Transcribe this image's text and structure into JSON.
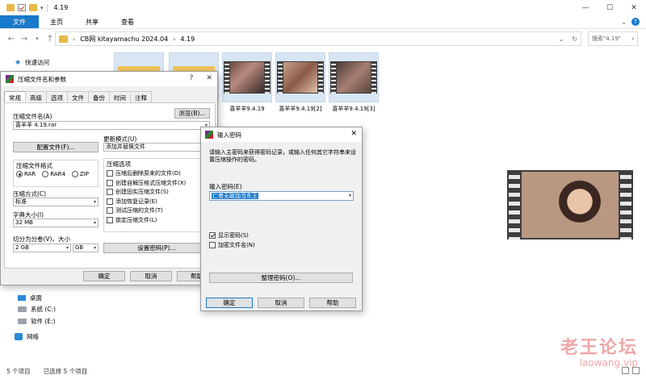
{
  "explorer": {
    "title": "4.19",
    "tabs": [
      "文件",
      "主页",
      "共享",
      "查看"
    ],
    "breadcrumb": [
      "CB网 kitayamachu 2024.04",
      "4.19"
    ],
    "search_placeholder": "搜索\"4.19\"",
    "nav": {
      "quick_access": "快速访问",
      "desktop": "桌面",
      "system_drive": "系统 (C:)",
      "software_drive": "软件 (E:)",
      "network": "网络"
    },
    "files": [
      {
        "type": "folder",
        "name": ""
      },
      {
        "type": "folder",
        "name": ""
      },
      {
        "type": "video",
        "name": "喜羊羊9.4.19"
      },
      {
        "type": "video",
        "name": "喜羊羊9.4.19[2]"
      },
      {
        "type": "video",
        "name": "喜羊羊9.4.19[3]"
      }
    ],
    "status": {
      "count": "5 个项目",
      "selected": "已选择 5 个项目"
    }
  },
  "archive_dialog": {
    "title": "压缩文件名和参数",
    "help": "?",
    "tabs": [
      "常规",
      "高级",
      "选项",
      "文件",
      "备份",
      "时间",
      "注释"
    ],
    "archive_name_label": "压缩文件名(A)",
    "browse_button": "浏览(B)...",
    "archive_name": "喜羊羊 4.19.rar",
    "update_mode_label": "更新模式(U)",
    "update_mode": "添加并替换文件",
    "profiles_button": "配置文件(F)...",
    "format_label": "压缩文件格式",
    "formats": [
      "RAR",
      "RAR4",
      "ZIP"
    ],
    "selected_format": "RAR",
    "options_label": "压缩选项",
    "options": [
      {
        "label": "压缩后删除原来的文件(D)",
        "checked": false
      },
      {
        "label": "创建自解压格式压缩文件(X)",
        "checked": false
      },
      {
        "label": "创建固实压缩文件(S)",
        "checked": false
      },
      {
        "label": "添加恢复记录(E)",
        "checked": false
      },
      {
        "label": "测试压缩的文件(T)",
        "checked": false
      },
      {
        "label": "锁定压缩文件(L)",
        "checked": false
      }
    ],
    "method_label": "压缩方式(C)",
    "method": "标准",
    "dict_label": "字典大小(I)",
    "dict": "32 MB",
    "split_label": "切分为分卷(V)，大小",
    "split_size": "2 GB",
    "split_unit": "GB",
    "set_password_button": "设置密码(P)...",
    "ok_button": "确定",
    "cancel_button": "取消",
    "help_button": "帮助"
  },
  "password_dialog": {
    "title": "输入密码",
    "description": "请输入主密码来获得密码记录，或输入任何其它字符串来设置压缩操作的密码。",
    "input_label": "输入密码(E)",
    "password_value": "仁者无敌加当东王",
    "show_password_label": "显示密码(S)",
    "show_password_checked": true,
    "encrypt_names_label": "加密文件名(N)",
    "encrypt_names_checked": false,
    "organize_button": "整理密码(O)...",
    "ok_button": "确定",
    "cancel_button": "取消",
    "help_button": "帮助"
  },
  "watermark": {
    "text": "老王论坛",
    "url": "laowang.vip"
  }
}
